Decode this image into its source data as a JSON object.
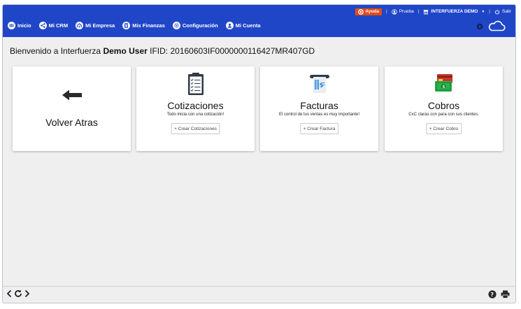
{
  "topbar": {
    "help": "Ayuda",
    "user": "Prueba",
    "company": "INTERFUERZA DEMO",
    "logout": "Salir"
  },
  "nav": {
    "items": [
      {
        "label": "Inicio",
        "icon": "home-icon"
      },
      {
        "label": "Mi CRM",
        "icon": "share-icon"
      },
      {
        "label": "Mi Empresa",
        "icon": "building-icon"
      },
      {
        "label": "Mis Finanzas",
        "icon": "calculator-icon"
      },
      {
        "label": "Configuración",
        "icon": "gear-icon"
      },
      {
        "label": "Mi Cuenta",
        "icon": "user-icon"
      }
    ]
  },
  "welcome": {
    "prefix": "Bienvenido a Interfuerza",
    "user": "Demo User",
    "ifid": "IFID: 20160603IF0000000116427MR407GD"
  },
  "cards": {
    "back": {
      "title": "Volver Atras",
      "icon": "arrow-left-icon"
    },
    "quotes": {
      "title": "Cotizaciones",
      "subtitle": "Todo inicia con una cotización!",
      "button": "+ Crear Cotizaciones",
      "icon": "clipboard-icon"
    },
    "invoices": {
      "title": "Facturas",
      "subtitle": "El control de tus ventas es muy importante!",
      "button": "+ Crear Factura",
      "icon": "invoice-icon"
    },
    "payments": {
      "title": "Cobros",
      "subtitle": "CxC claras con para con sus clientes.",
      "button": "+ Crear Cobro",
      "icon": "money-icon"
    }
  },
  "colors": {
    "header": "#2046c8",
    "help": "#e54b17",
    "background": "#efefef"
  }
}
